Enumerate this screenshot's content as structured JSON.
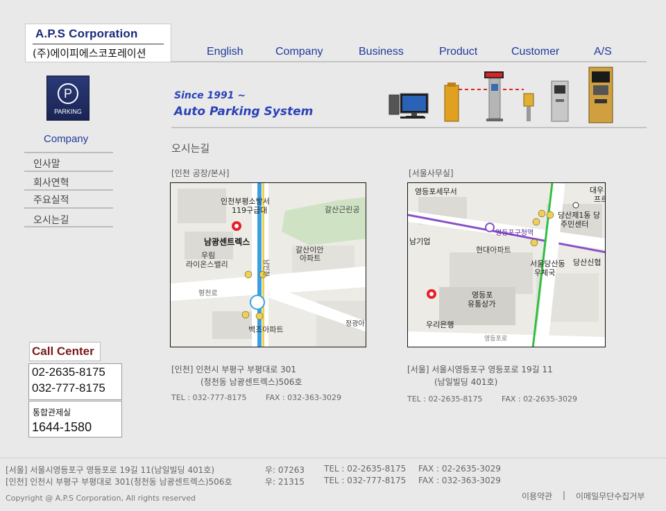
{
  "logo": {
    "en": "A.P.S Corporation",
    "ko": "(주)에이피에스코포레이션"
  },
  "nav": [
    "English",
    "Company",
    "Business",
    "Product",
    "Customer",
    "A/S"
  ],
  "badge": {
    "letter": "P",
    "text": "PARKING"
  },
  "banner": {
    "since": "Since 1991 ~",
    "slogan": "Auto Parking System"
  },
  "sidebar": {
    "title": "Company",
    "items": [
      "인사말",
      "회사연혁",
      "주요실적",
      "오시는길"
    ]
  },
  "page_title": "오시는길",
  "sections": {
    "incheon": {
      "heading": "[인천 공장/본사]",
      "addr1": "[인천] 인천시 부평구 부평대로 301",
      "addr2": "(청천동 남광센트렉스)506호",
      "tel": "TEL : 032-777-8175",
      "fax": "FAX : 032-363-3029",
      "map_labels": [
        "인천부평소방서",
        "119구급대",
        "갈산근린공",
        "남광센트렉스",
        "갈산이안",
        "아파트",
        "우림",
        "라이온스밸리",
        "평천로",
        "백조아파트",
        "정광아",
        "남인천"
      ]
    },
    "seoul": {
      "heading": "[서울사무실]",
      "addr1": "[서울] 서울시영등포구 영등포로 19길 11",
      "addr2": "(남일빌딩 401호)",
      "tel": "TEL : 02-2635-8175",
      "fax": "FAX : 02-2635-3029",
      "map_labels": [
        "영등포세무서",
        "대우",
        "프르",
        "당산제1동 당",
        "주민센터",
        "영등포구청역",
        "남기업",
        "현대아파트",
        "서울당산동",
        "우체국",
        "당산신협",
        "영등포",
        "유통상가",
        "우리은행",
        "영등포로"
      ]
    }
  },
  "call_center": {
    "title": "Call Center",
    "phones": [
      "02-2635-8175",
      "032-777-8175"
    ],
    "total_label": "통합관제실",
    "total_phone": "1644-1580"
  },
  "footer": {
    "seoul": {
      "addr": "[서울] 서울시영등포구 영등포로 19길 11(남일빌딩 401호)",
      "zip": "우: 07263",
      "tel": "TEL : 02-2635-8175",
      "fax": "FAX : 02-2635-3029"
    },
    "incheon": {
      "addr": "[인천] 인천시 부평구 부평대로 301(청천동 남광센트렉스)506호",
      "zip": "우: 21315",
      "tel": "TEL : 032-777-8175",
      "fax": "FAX : 032-363-3029"
    },
    "copyright": "Copyright @ A.P.S Corporation, All rights reserved",
    "links": [
      "이용약관",
      "이메일무단수집거부"
    ],
    "separator": "|"
  },
  "colors": {
    "accent": "#1f3a9a",
    "banner": "#2a42b8",
    "callcenter": "#7a1a1a",
    "marker": "#e8202a"
  }
}
